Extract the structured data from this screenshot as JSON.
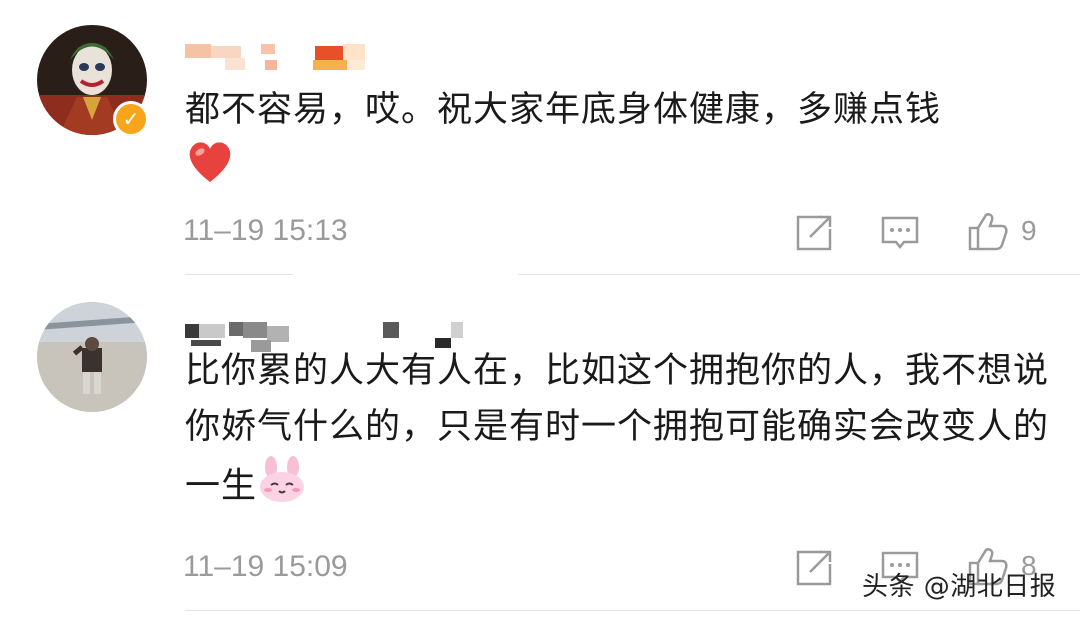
{
  "comments": [
    {
      "text": "都不容易，哎。祝大家年底身体健康，多赚点钱",
      "emoji": "heart",
      "time": "11–19 15:13",
      "like_count": "9"
    },
    {
      "text": "比你累的人大有人在，比如这个拥抱你的人，我不想说你娇气什么的，只是有时一个拥抱可能确实会改变人的一生",
      "emoji": "pink-bunny",
      "time": "11–19 15:09",
      "like_count": "8"
    }
  ],
  "watermark": "头条 @湖北日报",
  "icons": {
    "share": "share-icon",
    "reply": "comment-icon",
    "like": "thumbs-up-icon",
    "verified": "verified-badge-icon"
  },
  "colors": {
    "verified_badge": "#f7a61b",
    "text": "#1a1a1a",
    "meta": "#9a9a9a",
    "heart": "#e8423f"
  }
}
